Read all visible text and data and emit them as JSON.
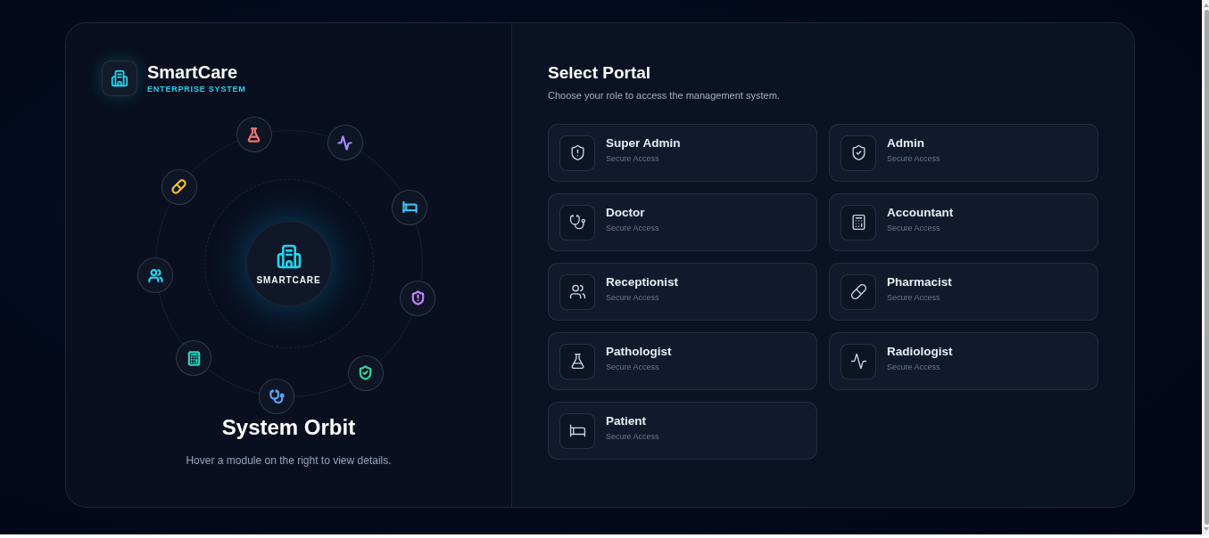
{
  "brand": {
    "name": "SmartCare",
    "tagline": "ENTERPRISE SYSTEM"
  },
  "orbit": {
    "hub_label": "SMARTCARE",
    "nodes": [
      {
        "kind": "alert",
        "color": "#c084fc"
      },
      {
        "kind": "shield",
        "color": "#34d399"
      },
      {
        "kind": "stethoscope",
        "color": "#60a5fa"
      },
      {
        "kind": "calculator",
        "color": "#2dd4bf"
      },
      {
        "kind": "users",
        "color": "#22d3ee"
      },
      {
        "kind": "pill",
        "color": "#fbbf24"
      },
      {
        "kind": "flask",
        "color": "#f87171"
      },
      {
        "kind": "pulse",
        "color": "#a78bfa"
      },
      {
        "kind": "bed",
        "color": "#38bdf8"
      }
    ],
    "title": "System Orbit",
    "hint": "Hover a module on the right to view details."
  },
  "portal": {
    "title": "Select Portal",
    "subtitle": "Choose your role to access the management system.",
    "roles": [
      {
        "name": "Super Admin",
        "caption": "Secure Access",
        "kind": "alert"
      },
      {
        "name": "Admin",
        "caption": "Secure Access",
        "kind": "shield"
      },
      {
        "name": "Doctor",
        "caption": "Secure Access",
        "kind": "stethoscope"
      },
      {
        "name": "Accountant",
        "caption": "Secure Access",
        "kind": "calculator"
      },
      {
        "name": "Receptionist",
        "caption": "Secure Access",
        "kind": "users"
      },
      {
        "name": "Pharmacist",
        "caption": "Secure Access",
        "kind": "pill"
      },
      {
        "name": "Pathologist",
        "caption": "Secure Access",
        "kind": "flask"
      },
      {
        "name": "Radiologist",
        "caption": "Secure Access",
        "kind": "pulse"
      },
      {
        "name": "Patient",
        "caption": "Secure Access",
        "kind": "bed"
      }
    ]
  }
}
